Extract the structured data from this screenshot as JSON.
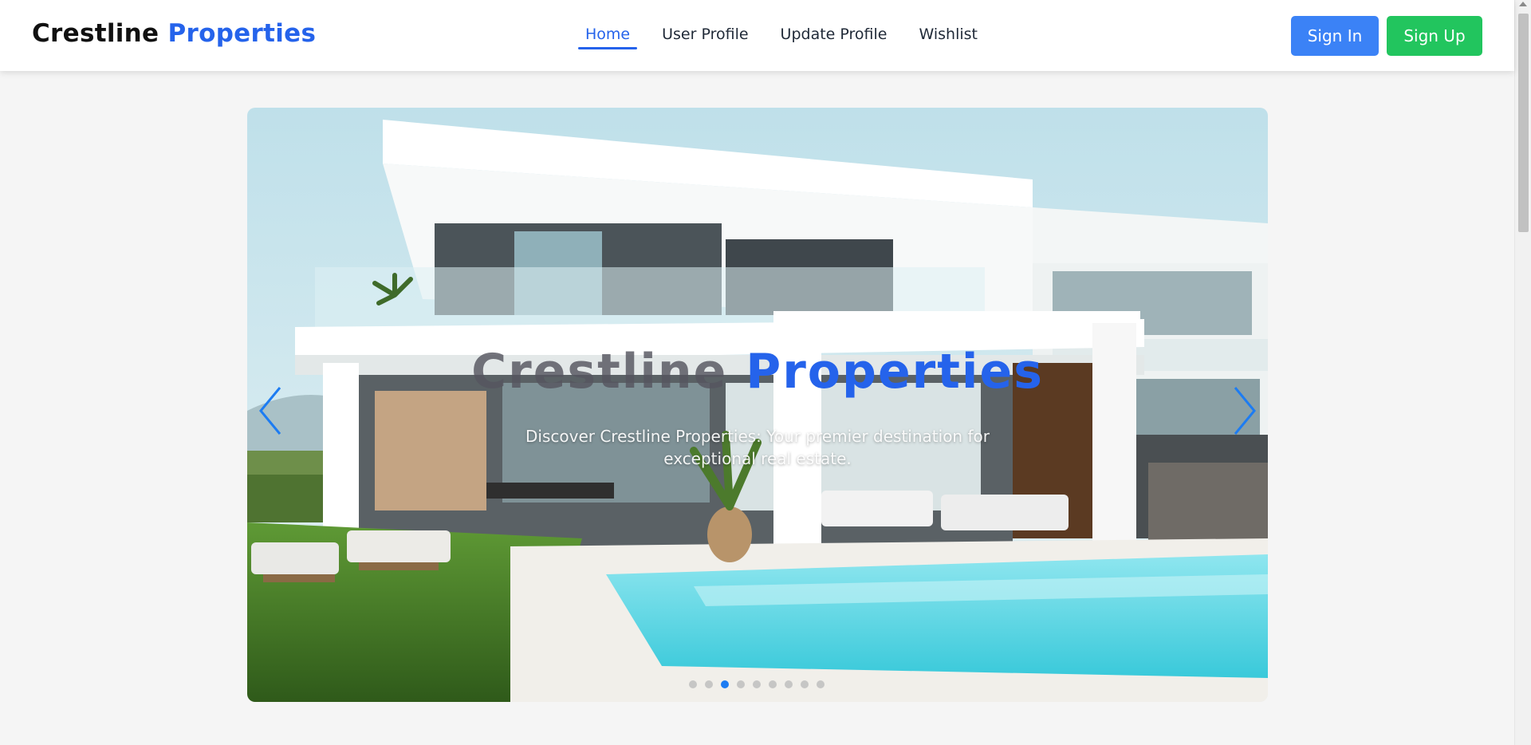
{
  "brand": {
    "name_main": "Crestline",
    "name_accent": "Properties"
  },
  "nav": {
    "links": [
      {
        "label": "Home",
        "active": true
      },
      {
        "label": "User Profile",
        "active": false
      },
      {
        "label": "Update Profile",
        "active": false
      },
      {
        "label": "Wishlist",
        "active": false
      }
    ]
  },
  "auth": {
    "sign_in_label": "Sign In",
    "sign_up_label": "Sign Up"
  },
  "hero": {
    "title_main": "Crestline",
    "title_accent": "Properties",
    "subtitle": "Discover Crestline Properties: Your premier destination for exceptional real estate.",
    "slide_count": 9,
    "active_slide": 3
  },
  "icons": {
    "prev": "chevron-left-icon",
    "next": "chevron-right-icon"
  },
  "colors": {
    "brand_accent": "#2563eb",
    "sign_in_bg": "#3b82f6",
    "sign_up_bg": "#22c55e",
    "carousel_arrow": "#1d7cf2",
    "active_dot": "#1d7cf2"
  }
}
